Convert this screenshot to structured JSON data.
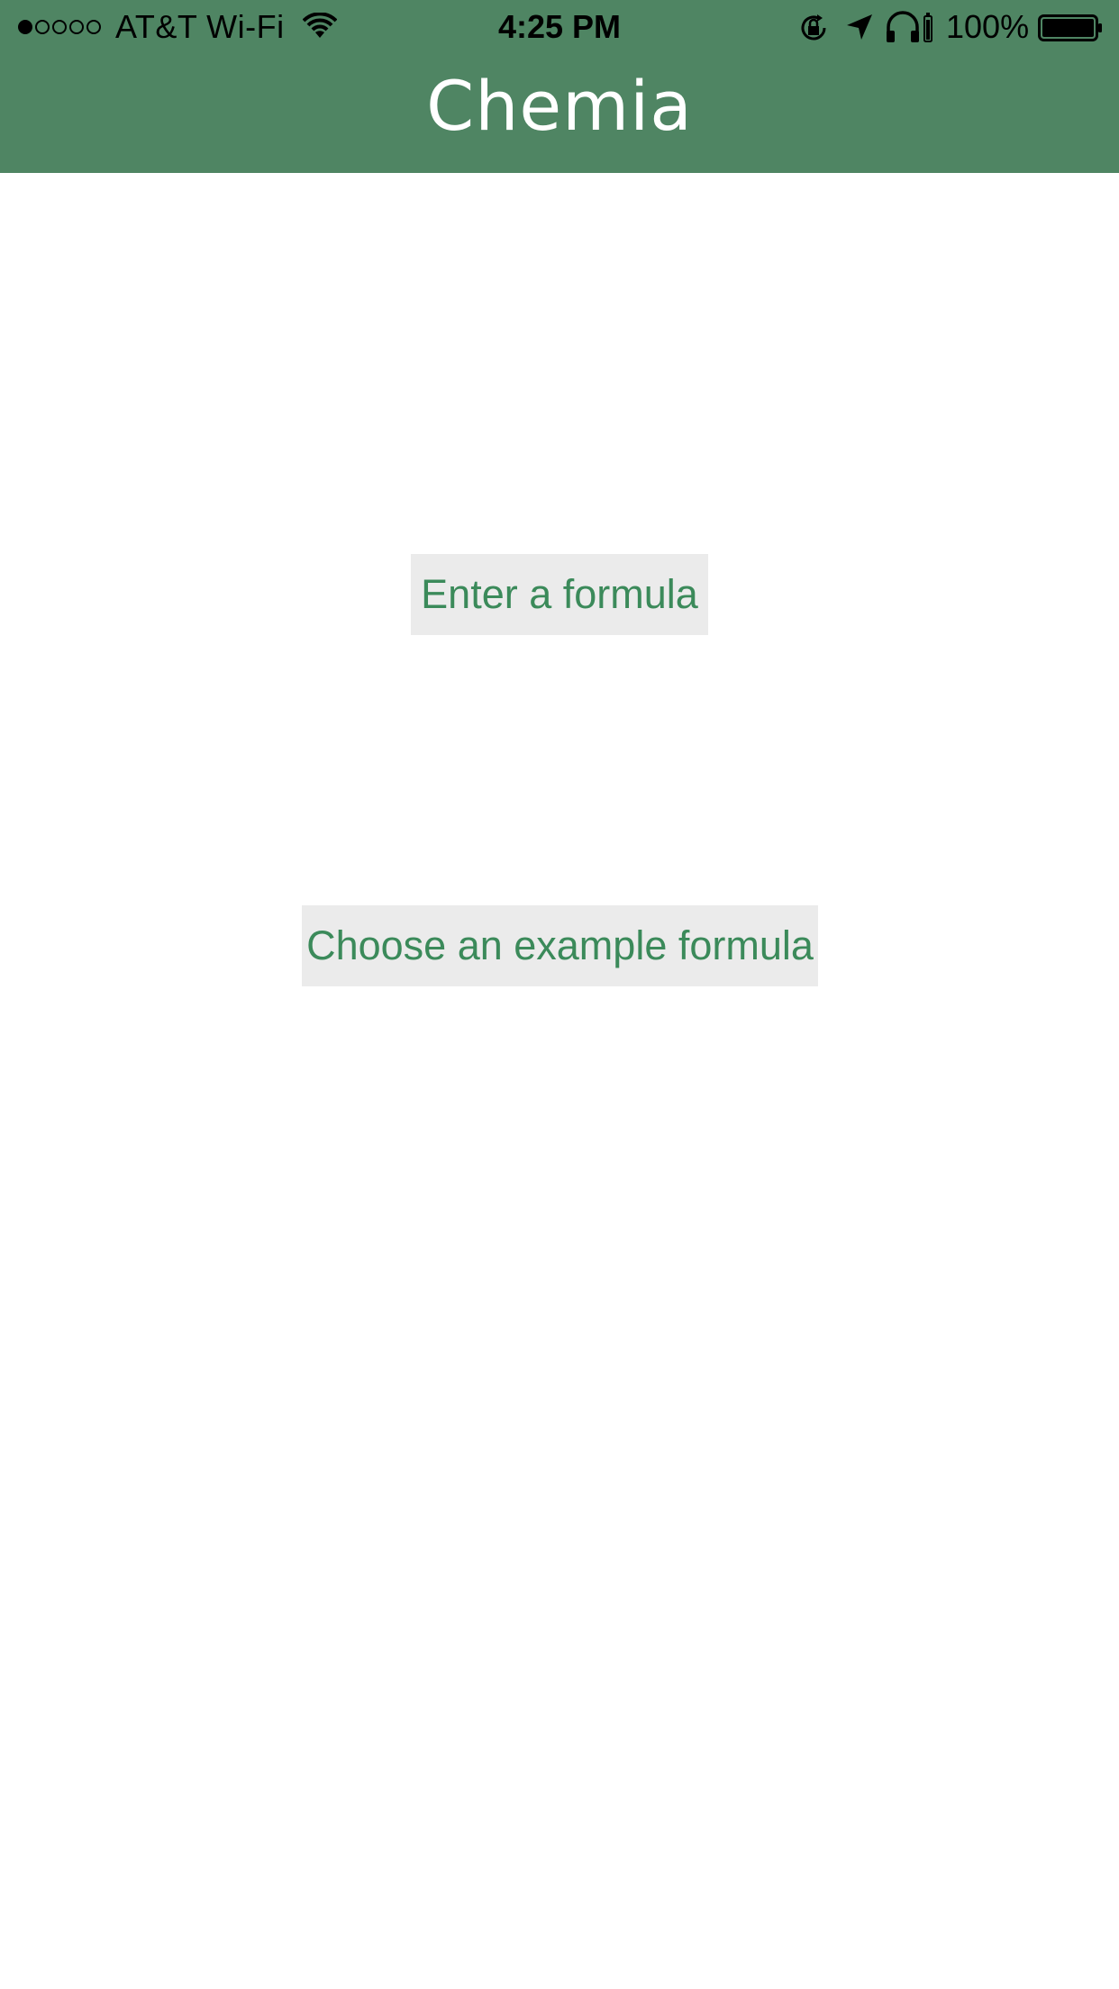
{
  "status_bar": {
    "signal_bars_filled": 1,
    "signal_bars_total": 5,
    "carrier": "AT&T Wi-Fi",
    "time": "4:25 PM",
    "battery_percent": "100%",
    "icons": [
      "wifi-icon",
      "rotation-lock-icon",
      "location-arrow-icon",
      "headphones-icon",
      "battery-icon"
    ]
  },
  "header": {
    "title": "Chemia",
    "background_color": "#4f8563"
  },
  "main": {
    "enter_formula_label": "Enter a formula",
    "example_formula_label": "Choose an example formula",
    "button_text_color": "#3b8a5a",
    "button_background_color": "#ebebeb"
  }
}
